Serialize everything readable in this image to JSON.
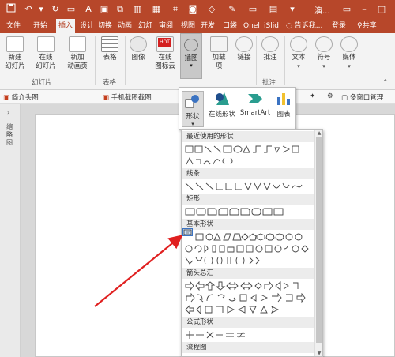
{
  "window": {
    "title": "演...",
    "share_label": "共享",
    "signin_label": "登录"
  },
  "tabs": [
    {
      "label": "文件"
    },
    {
      "label": "开始"
    },
    {
      "label": "插入"
    },
    {
      "label": "设计"
    },
    {
      "label": "切换"
    },
    {
      "label": "动画"
    },
    {
      "label": "幻灯"
    },
    {
      "label": "审阅"
    },
    {
      "label": "视图"
    },
    {
      "label": "开发"
    },
    {
      "label": "口袋"
    },
    {
      "label": "Onel"
    },
    {
      "label": "iSlid"
    },
    {
      "label": "告诉我..."
    }
  ],
  "ribbon": {
    "new_slide": "新建\n幻灯片",
    "online_slide": "在线\n幻灯片",
    "new_anim_page": "新加\n动画页",
    "table": "表格",
    "image": "图像",
    "online_icon_cloud": "在线\n图标云",
    "illustrations": "插图",
    "addins": "加载\n项",
    "link": "链接",
    "comment": "批注",
    "text": "文本",
    "symbol": "符号",
    "media": "媒体",
    "group_slides": "幻灯片",
    "group_table": "表格",
    "group_comments": "批注",
    "hot_badge": "HOT"
  },
  "docbar": {
    "item1": "简介头图",
    "item2": "手机截图截图",
    "item3": "多窗口管理"
  },
  "left_pane_label": "缩略图",
  "dropdown": {
    "shapes": "形状",
    "online_shapes": "在线形状",
    "smartart": "SmartArt",
    "chart": "图表"
  },
  "gallery": {
    "sections": [
      {
        "title": "最近使用的形状"
      },
      {
        "title": "线条"
      },
      {
        "title": "矩形"
      },
      {
        "title": "基本形状"
      },
      {
        "title": "箭头总汇"
      },
      {
        "title": "公式形状"
      },
      {
        "title": "流程图"
      }
    ]
  },
  "colors": {
    "brand": "#b7472a",
    "ribbon_bg": "#f3f3f3",
    "arrow": "#e02020",
    "selection": "#3b73c2"
  }
}
